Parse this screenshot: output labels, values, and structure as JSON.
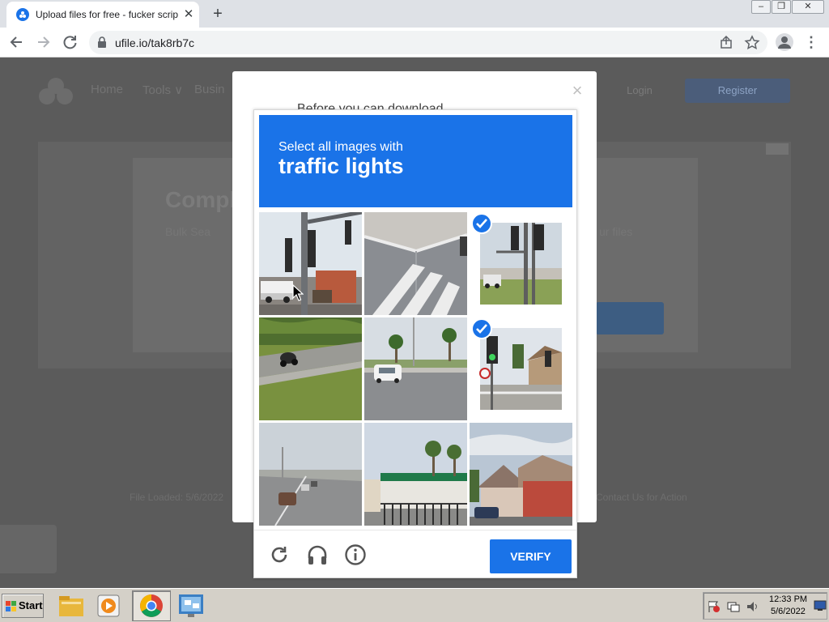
{
  "browser": {
    "tab_title": "Upload files for free - fucker scrip",
    "tab_close": "✕",
    "new_tab": "+",
    "url": "ufile.io/tak8rb7c",
    "win_minimize": "–",
    "win_restore": "❐",
    "win_close": "✕"
  },
  "site": {
    "nav_home": "Home",
    "nav_tools": "Tools ∨",
    "nav_business": "Busin",
    "login": "Login",
    "register": "Register",
    "heading": "Compl",
    "sub_left": "Bulk Sea",
    "sub_right": "ur files",
    "footer_left": "File Loaded: 5/6/2022",
    "footer_right": "Contact Us for Action"
  },
  "modal": {
    "close": "×",
    "peek_text": "Before you can download"
  },
  "captcha": {
    "prompt_line1": "Select all images with",
    "prompt_line2": "traffic lights",
    "verify_label": "VERIFY",
    "accent_color": "#1a73e8",
    "tiles": [
      {
        "subject": "intersection with traffic lights and truck",
        "selected": false
      },
      {
        "subject": "crosswalk corner",
        "selected": false
      },
      {
        "subject": "traffic lights at intersection",
        "selected": true
      },
      {
        "subject": "motorcycle on road with grass",
        "selected": false
      },
      {
        "subject": "car on road with palm trees",
        "selected": false
      },
      {
        "subject": "green traffic light with no-turn sign",
        "selected": true
      },
      {
        "subject": "highway with cars",
        "selected": false
      },
      {
        "subject": "storefront with palm trees",
        "selected": false
      },
      {
        "subject": "houses and car",
        "selected": false
      }
    ]
  },
  "taskbar": {
    "start_label": "Start",
    "time": "12:33 PM",
    "date": "5/6/2022"
  }
}
